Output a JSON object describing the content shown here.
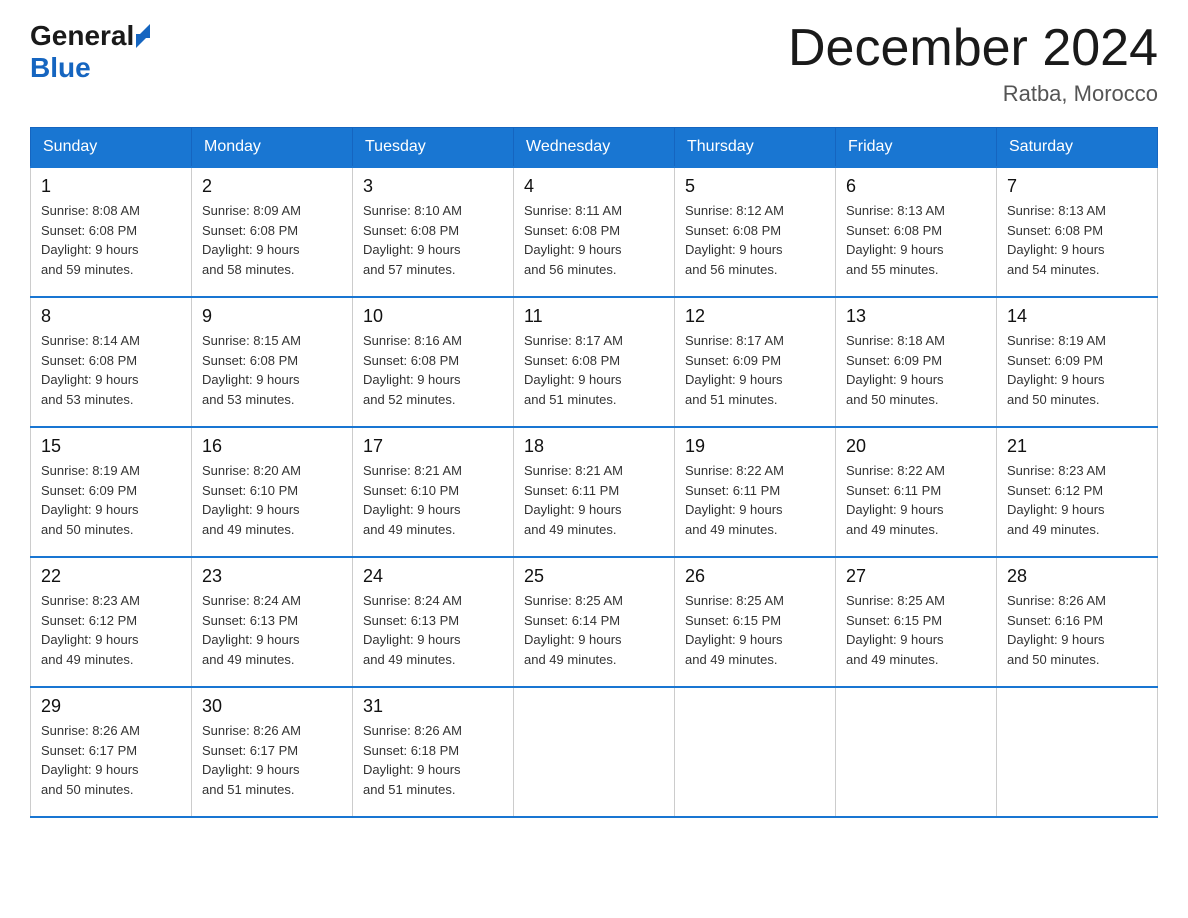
{
  "header": {
    "logo_general": "General",
    "logo_blue": "Blue",
    "month_title": "December 2024",
    "location": "Ratba, Morocco"
  },
  "weekdays": [
    "Sunday",
    "Monday",
    "Tuesday",
    "Wednesday",
    "Thursday",
    "Friday",
    "Saturday"
  ],
  "weeks": [
    [
      {
        "day": "1",
        "sunrise": "8:08 AM",
        "sunset": "6:08 PM",
        "daylight": "9 hours and 59 minutes."
      },
      {
        "day": "2",
        "sunrise": "8:09 AM",
        "sunset": "6:08 PM",
        "daylight": "9 hours and 58 minutes."
      },
      {
        "day": "3",
        "sunrise": "8:10 AM",
        "sunset": "6:08 PM",
        "daylight": "9 hours and 57 minutes."
      },
      {
        "day": "4",
        "sunrise": "8:11 AM",
        "sunset": "6:08 PM",
        "daylight": "9 hours and 56 minutes."
      },
      {
        "day": "5",
        "sunrise": "8:12 AM",
        "sunset": "6:08 PM",
        "daylight": "9 hours and 56 minutes."
      },
      {
        "day": "6",
        "sunrise": "8:13 AM",
        "sunset": "6:08 PM",
        "daylight": "9 hours and 55 minutes."
      },
      {
        "day": "7",
        "sunrise": "8:13 AM",
        "sunset": "6:08 PM",
        "daylight": "9 hours and 54 minutes."
      }
    ],
    [
      {
        "day": "8",
        "sunrise": "8:14 AM",
        "sunset": "6:08 PM",
        "daylight": "9 hours and 53 minutes."
      },
      {
        "day": "9",
        "sunrise": "8:15 AM",
        "sunset": "6:08 PM",
        "daylight": "9 hours and 53 minutes."
      },
      {
        "day": "10",
        "sunrise": "8:16 AM",
        "sunset": "6:08 PM",
        "daylight": "9 hours and 52 minutes."
      },
      {
        "day": "11",
        "sunrise": "8:17 AM",
        "sunset": "6:08 PM",
        "daylight": "9 hours and 51 minutes."
      },
      {
        "day": "12",
        "sunrise": "8:17 AM",
        "sunset": "6:09 PM",
        "daylight": "9 hours and 51 minutes."
      },
      {
        "day": "13",
        "sunrise": "8:18 AM",
        "sunset": "6:09 PM",
        "daylight": "9 hours and 50 minutes."
      },
      {
        "day": "14",
        "sunrise": "8:19 AM",
        "sunset": "6:09 PM",
        "daylight": "9 hours and 50 minutes."
      }
    ],
    [
      {
        "day": "15",
        "sunrise": "8:19 AM",
        "sunset": "6:09 PM",
        "daylight": "9 hours and 50 minutes."
      },
      {
        "day": "16",
        "sunrise": "8:20 AM",
        "sunset": "6:10 PM",
        "daylight": "9 hours and 49 minutes."
      },
      {
        "day": "17",
        "sunrise": "8:21 AM",
        "sunset": "6:10 PM",
        "daylight": "9 hours and 49 minutes."
      },
      {
        "day": "18",
        "sunrise": "8:21 AM",
        "sunset": "6:11 PM",
        "daylight": "9 hours and 49 minutes."
      },
      {
        "day": "19",
        "sunrise": "8:22 AM",
        "sunset": "6:11 PM",
        "daylight": "9 hours and 49 minutes."
      },
      {
        "day": "20",
        "sunrise": "8:22 AM",
        "sunset": "6:11 PM",
        "daylight": "9 hours and 49 minutes."
      },
      {
        "day": "21",
        "sunrise": "8:23 AM",
        "sunset": "6:12 PM",
        "daylight": "9 hours and 49 minutes."
      }
    ],
    [
      {
        "day": "22",
        "sunrise": "8:23 AM",
        "sunset": "6:12 PM",
        "daylight": "9 hours and 49 minutes."
      },
      {
        "day": "23",
        "sunrise": "8:24 AM",
        "sunset": "6:13 PM",
        "daylight": "9 hours and 49 minutes."
      },
      {
        "day": "24",
        "sunrise": "8:24 AM",
        "sunset": "6:13 PM",
        "daylight": "9 hours and 49 minutes."
      },
      {
        "day": "25",
        "sunrise": "8:25 AM",
        "sunset": "6:14 PM",
        "daylight": "9 hours and 49 minutes."
      },
      {
        "day": "26",
        "sunrise": "8:25 AM",
        "sunset": "6:15 PM",
        "daylight": "9 hours and 49 minutes."
      },
      {
        "day": "27",
        "sunrise": "8:25 AM",
        "sunset": "6:15 PM",
        "daylight": "9 hours and 49 minutes."
      },
      {
        "day": "28",
        "sunrise": "8:26 AM",
        "sunset": "6:16 PM",
        "daylight": "9 hours and 50 minutes."
      }
    ],
    [
      {
        "day": "29",
        "sunrise": "8:26 AM",
        "sunset": "6:17 PM",
        "daylight": "9 hours and 50 minutes."
      },
      {
        "day": "30",
        "sunrise": "8:26 AM",
        "sunset": "6:17 PM",
        "daylight": "9 hours and 51 minutes."
      },
      {
        "day": "31",
        "sunrise": "8:26 AM",
        "sunset": "6:18 PM",
        "daylight": "9 hours and 51 minutes."
      },
      null,
      null,
      null,
      null
    ]
  ],
  "labels": {
    "sunrise": "Sunrise:",
    "sunset": "Sunset:",
    "daylight": "Daylight:"
  }
}
